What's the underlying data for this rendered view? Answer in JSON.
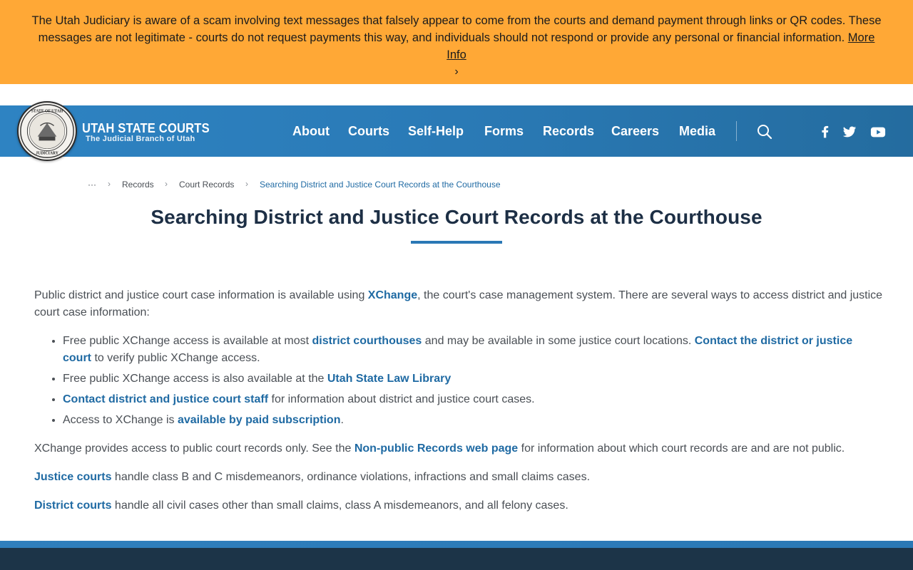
{
  "alert": {
    "message": "The Utah Judiciary is aware of a scam involving text messages that falsely appear to come from the courts and demand payment through links or QR codes. These messages are not legitimate - courts do not request payments this way, and individuals should not respond or provide any personal or financial information.",
    "link": "More Info",
    "chevron": "›"
  },
  "header": {
    "brand_title": "UTAH STATE COURTS",
    "brand_subtitle": "The Judicial Branch of Utah",
    "seal_text": "STATE OF UTAH JUDICIARY",
    "nav": [
      "About",
      "Courts",
      "Self-Help",
      "Forms",
      "Records",
      "Careers",
      "Media"
    ],
    "icons": [
      "search-icon",
      "facebook-icon",
      "twitter-icon",
      "youtube-icon"
    ]
  },
  "breadcrumb": {
    "ellipsis": "···",
    "items": [
      "Records",
      "Court Records",
      "Searching District and Justice Court Records at the Courthouse"
    ],
    "separator": "›"
  },
  "page": {
    "title": "Searching District and Justice Court Records at the Courthouse"
  },
  "content": {
    "intro": {
      "before": "Public district and justice court case information is available using ",
      "link": "XChange",
      "after": ", the court's case management system. There are several ways to access district and justice court case information:"
    },
    "bullets": [
      {
        "b1_text": "Free public XChange access is available at most ",
        "b1_link1": "district courthouses",
        "b1_mid": " and may be available in some justice court locations. ",
        "b1_link2": "Contact the district or justice court",
        "b1_end": " to verify public XChange access."
      },
      {
        "b2_text": "Free public XChange access is also available at the ",
        "b2_link": "Utah State Law Library"
      },
      {
        "b3_link": "Contact district and justice court staff",
        "b3_text": " for information about district and justice court cases."
      },
      {
        "b4_text": "Access to XChange is ",
        "b4_link": "available by paid subscription",
        "b4_end": "."
      }
    ],
    "p2_before": "XChange provides access to public court records only. See the ",
    "p2_link": "Non-public Records web page",
    "p2_after": " for information about which court records are and are not public.",
    "p3_link": "Justice courts",
    "p3_text": " handle class B and C misdemeanors, ordinance violations, infractions and small claims cases.",
    "p4_link": "District courts",
    "p4_text": " handle all civil cases other than small claims, class A misdemeanors, and all felony cases."
  },
  "colors": {
    "alert_bg": "#ffa836",
    "nav_bg": "#2a7ab6",
    "link": "#1f6aa3",
    "title": "#1d2f45",
    "footer": "#1c3448"
  }
}
